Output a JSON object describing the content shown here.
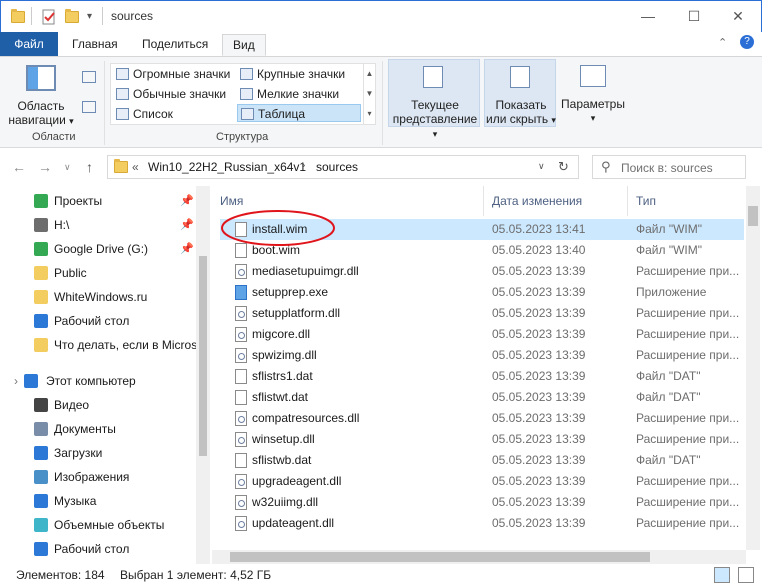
{
  "window": {
    "title": "sources"
  },
  "ribbon_tabs": [
    "Файл",
    "Главная",
    "Поделиться",
    "Вид"
  ],
  "ribbon": {
    "nav_pane_btn": "Область навигации",
    "nav_pane_btn_l1": "Область",
    "nav_pane_btn_l2": "навигации",
    "group_panes": "Области",
    "layouts": {
      "huge_icons": "Огромные значки",
      "large_icons": "Крупные значки",
      "normal_icons": "Обычные значки",
      "small_icons": "Мелкие значки",
      "list": "Список",
      "details": "Таблица"
    },
    "group_layout": "Структура",
    "current_view_l1": "Текущее",
    "current_view_l2": "представление",
    "show_hide_l1": "Показать",
    "show_hide_l2": "или скрыть",
    "options": "Параметры"
  },
  "address": {
    "crumb_root": "Win10_22H2_Russian_x64v1",
    "crumb_current": "sources",
    "search_placeholder": "Поиск в: sources"
  },
  "nav_items": [
    {
      "label": "Проекты",
      "icon": "google-drive-icon",
      "pinned": true
    },
    {
      "label": "H:\\",
      "icon": "drive-icon",
      "pinned": true
    },
    {
      "label": "Google Drive (G:)",
      "icon": "google-drive-icon",
      "pinned": true
    },
    {
      "label": "Public",
      "icon": "folder-icon",
      "pinned": false
    },
    {
      "label": "WhiteWindows.ru",
      "icon": "folder-icon",
      "pinned": false
    },
    {
      "label": "Рабочий стол",
      "icon": "desktop-icon",
      "pinned": false
    },
    {
      "label": "Что делать, если в Micros",
      "icon": "folder-icon",
      "pinned": false
    }
  ],
  "nav_tree": [
    {
      "label": "Этот компьютер",
      "icon": "computer-icon"
    },
    {
      "label": "Видео",
      "icon": "video-icon"
    },
    {
      "label": "Документы",
      "icon": "documents-icon"
    },
    {
      "label": "Загрузки",
      "icon": "downloads-icon"
    },
    {
      "label": "Изображения",
      "icon": "pictures-icon"
    },
    {
      "label": "Музыка",
      "icon": "music-icon"
    },
    {
      "label": "Объемные объекты",
      "icon": "3d-objects-icon"
    },
    {
      "label": "Рабочий стол",
      "icon": "desktop-icon"
    }
  ],
  "columns": {
    "name": "Имя",
    "date": "Дата изменения",
    "type": "Тип"
  },
  "files": [
    {
      "name": "install.wim",
      "date": "05.05.2023 13:41",
      "type": "Файл \"WIM\"",
      "selected": true,
      "icon": "file"
    },
    {
      "name": "boot.wim",
      "date": "05.05.2023 13:40",
      "type": "Файл \"WIM\"",
      "icon": "file"
    },
    {
      "name": "mediasetupuimgr.dll",
      "date": "05.05.2023 13:39",
      "type": "Расширение при...",
      "icon": "dll"
    },
    {
      "name": "setupprep.exe",
      "date": "05.05.2023 13:39",
      "type": "Приложение",
      "icon": "exe"
    },
    {
      "name": "setupplatform.dll",
      "date": "05.05.2023 13:39",
      "type": "Расширение при...",
      "icon": "dll"
    },
    {
      "name": "migcore.dll",
      "date": "05.05.2023 13:39",
      "type": "Расширение при...",
      "icon": "dll"
    },
    {
      "name": "spwizimg.dll",
      "date": "05.05.2023 13:39",
      "type": "Расширение при...",
      "icon": "dll"
    },
    {
      "name": "sflistrs1.dat",
      "date": "05.05.2023 13:39",
      "type": "Файл \"DAT\"",
      "icon": "file"
    },
    {
      "name": "sflistwt.dat",
      "date": "05.05.2023 13:39",
      "type": "Файл \"DAT\"",
      "icon": "file"
    },
    {
      "name": "compatresources.dll",
      "date": "05.05.2023 13:39",
      "type": "Расширение при...",
      "icon": "dll"
    },
    {
      "name": "winsetup.dll",
      "date": "05.05.2023 13:39",
      "type": "Расширение при...",
      "icon": "dll"
    },
    {
      "name": "sflistwb.dat",
      "date": "05.05.2023 13:39",
      "type": "Файл \"DAT\"",
      "icon": "file"
    },
    {
      "name": "upgradeagent.dll",
      "date": "05.05.2023 13:39",
      "type": "Расширение при...",
      "icon": "dll"
    },
    {
      "name": "w32uiimg.dll",
      "date": "05.05.2023 13:39",
      "type": "Расширение при...",
      "icon": "dll"
    },
    {
      "name": "updateagent.dll",
      "date": "05.05.2023 13:39",
      "type": "Расширение при...",
      "icon": "dll"
    }
  ],
  "status": {
    "count": "Элементов: 184",
    "selection": "Выбран 1 элемент: 4,52 ГБ"
  },
  "colors": {
    "accent": "#1e5fa8",
    "selection": "#cce8ff",
    "annotation": "#e0151c"
  }
}
